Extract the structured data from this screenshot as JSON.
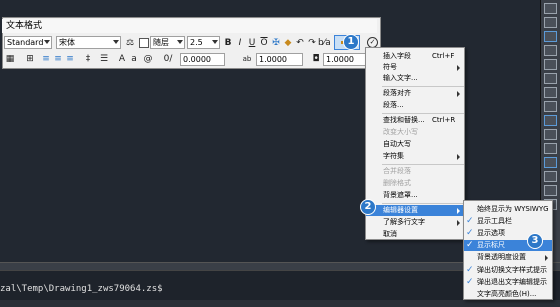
{
  "editor": {
    "title": "文本格式",
    "style": "Standard",
    "font": "宋体",
    "color_name": "随层",
    "height": "2.5",
    "bold": "B",
    "italic": "I",
    "underline": "U",
    "overline": "O",
    "undo": "↶",
    "redo": "↷",
    "oblique_value": "0.0000",
    "tracking_label": "ab",
    "tracking_value": "1.0000",
    "width_value": "1.0000"
  },
  "menu1": {
    "items": [
      {
        "label": "插入字段",
        "shortcut": "Ctrl+F"
      },
      {
        "label": "符号",
        "submenu": true
      },
      {
        "label": "输入文字..."
      },
      {
        "label": "段落对齐",
        "submenu": true
      },
      {
        "label": "段落..."
      },
      {
        "label": "查找和替换...",
        "shortcut": "Ctrl+R"
      },
      {
        "label": "改变大小写",
        "disabled": true
      },
      {
        "label": "自动大写"
      },
      {
        "label": "字符集",
        "submenu": true
      },
      {
        "label": "合并段落",
        "disabled": true
      },
      {
        "label": "删除格式",
        "disabled": true
      },
      {
        "label": "背景遮罩..."
      },
      {
        "label": "编辑器设置",
        "submenu": true
      },
      {
        "label": "了解多行文字",
        "submenu": true
      },
      {
        "label": "取消"
      }
    ]
  },
  "menu2": {
    "items": [
      {
        "label": "始终显示为 WYSIWYG",
        "checked": false
      },
      {
        "label": "显示工具栏",
        "checked": true
      },
      {
        "label": "显示选项",
        "checked": true
      },
      {
        "label": "显示标尺",
        "checked": true
      },
      {
        "label": "背景透明度设置",
        "checked": false,
        "submenu": true
      },
      {
        "label": "弹出切换文字样式提示",
        "checked": true
      },
      {
        "label": "弹出退出文字编辑提示",
        "checked": true
      },
      {
        "label": "文字高亮颜色(H)...",
        "checked": false
      }
    ]
  },
  "badges": [
    "1",
    "2",
    "3"
  ],
  "command": {
    "line": "zal\\Temp\\Drawing1_zws79064.zs$"
  },
  "colors": {
    "accent": "#3b83d9",
    "badge": "#2d78c8",
    "canvas": "#222831"
  }
}
